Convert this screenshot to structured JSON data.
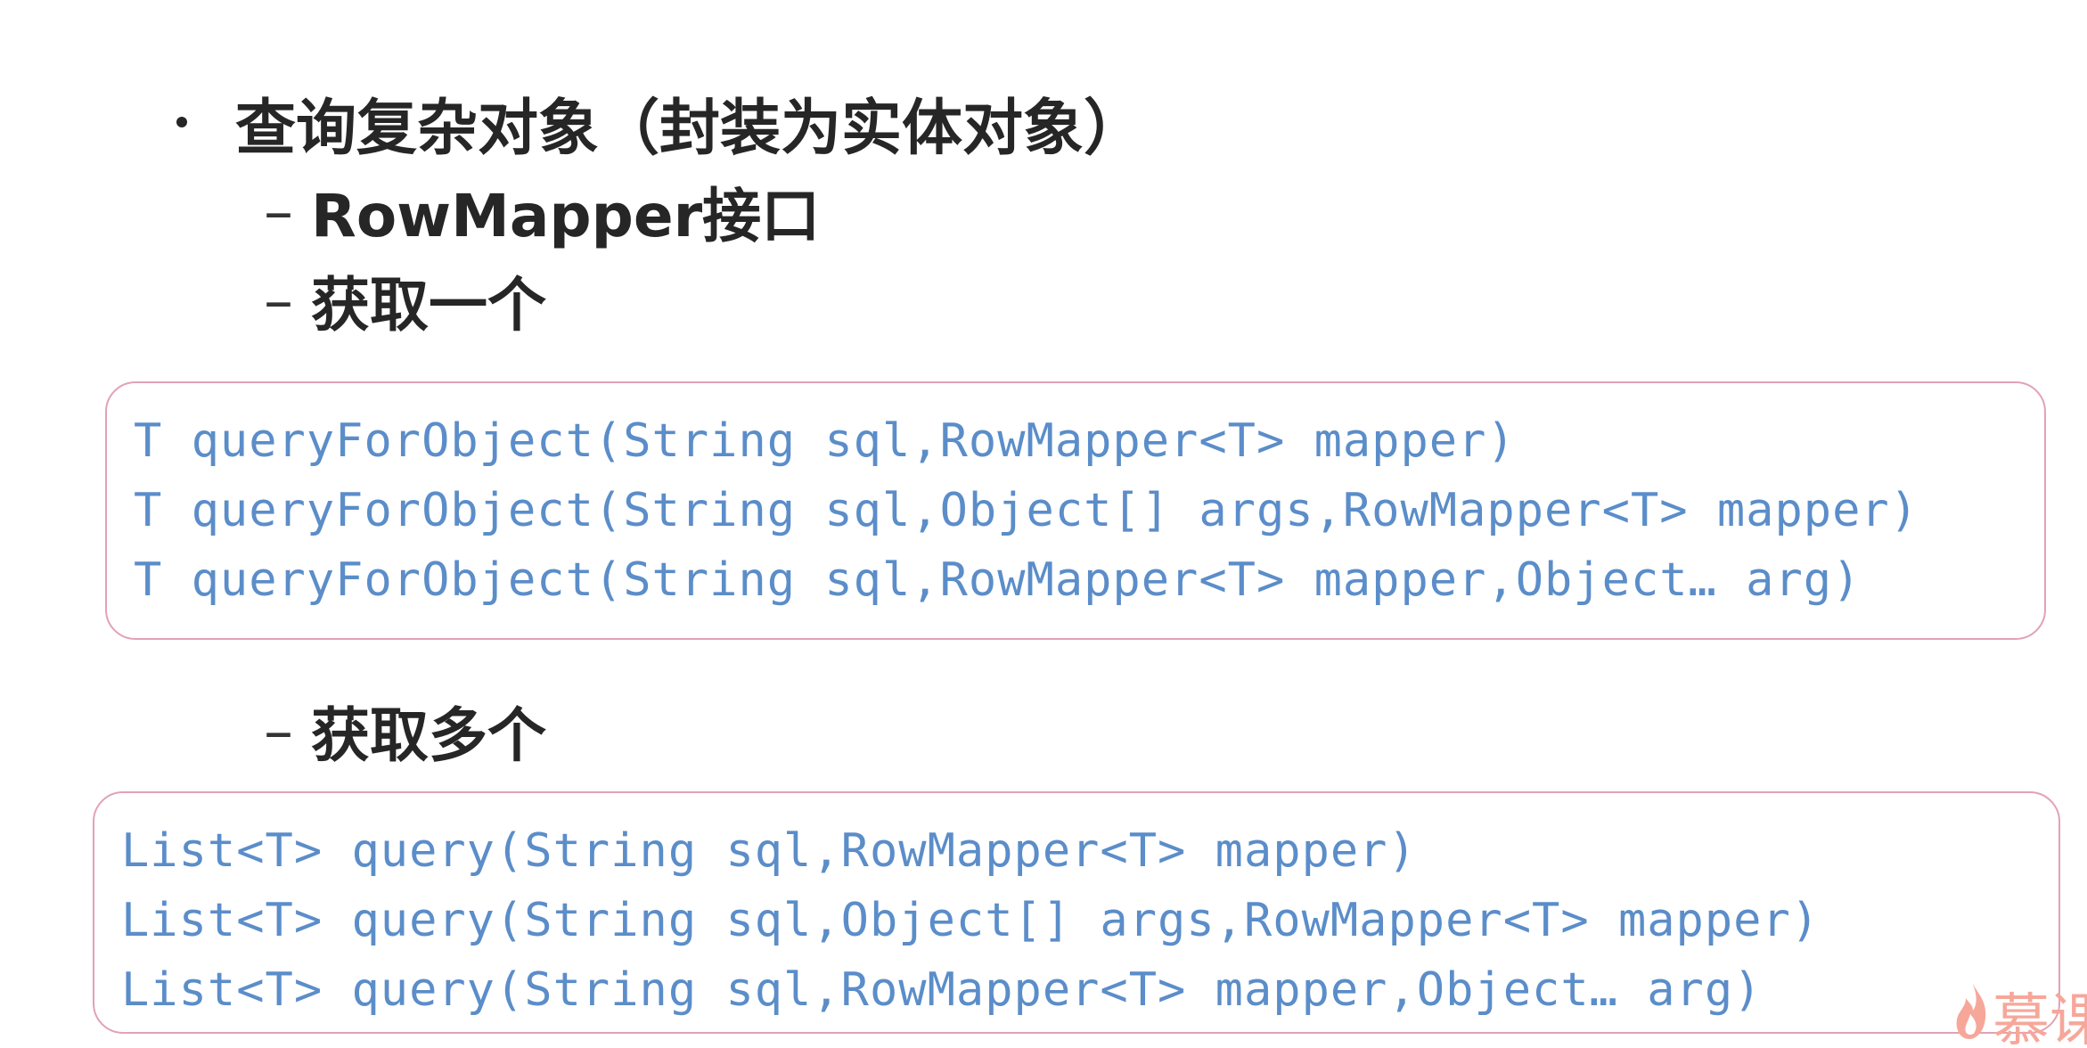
{
  "heading": "查询复杂对象（封装为实体对象）",
  "subitems": {
    "rowmapper": "RowMapper接口",
    "get_one": "获取一个",
    "get_many": "获取多个",
    "dash": "–"
  },
  "code_one": [
    "T queryForObject(String sql,RowMapper<T> mapper)",
    "T queryForObject(String sql,Object[] args,RowMapper<T> mapper)",
    "T queryForObject(String sql,RowMapper<T> mapper,Object… arg)"
  ],
  "code_many": [
    "List<T> query(String sql,RowMapper<T> mapper)",
    "List<T> query(String sql,Object[] args,RowMapper<T> mapper)",
    "List<T> query(String sql,RowMapper<T> mapper,Object… arg)"
  ],
  "watermark": {
    "text": "慕课",
    "icon": "flame-icon"
  },
  "colors": {
    "text": "#262626",
    "code": "#5b8dc9",
    "box_border": "#e2a2b4",
    "watermark": "#f6a79a"
  }
}
